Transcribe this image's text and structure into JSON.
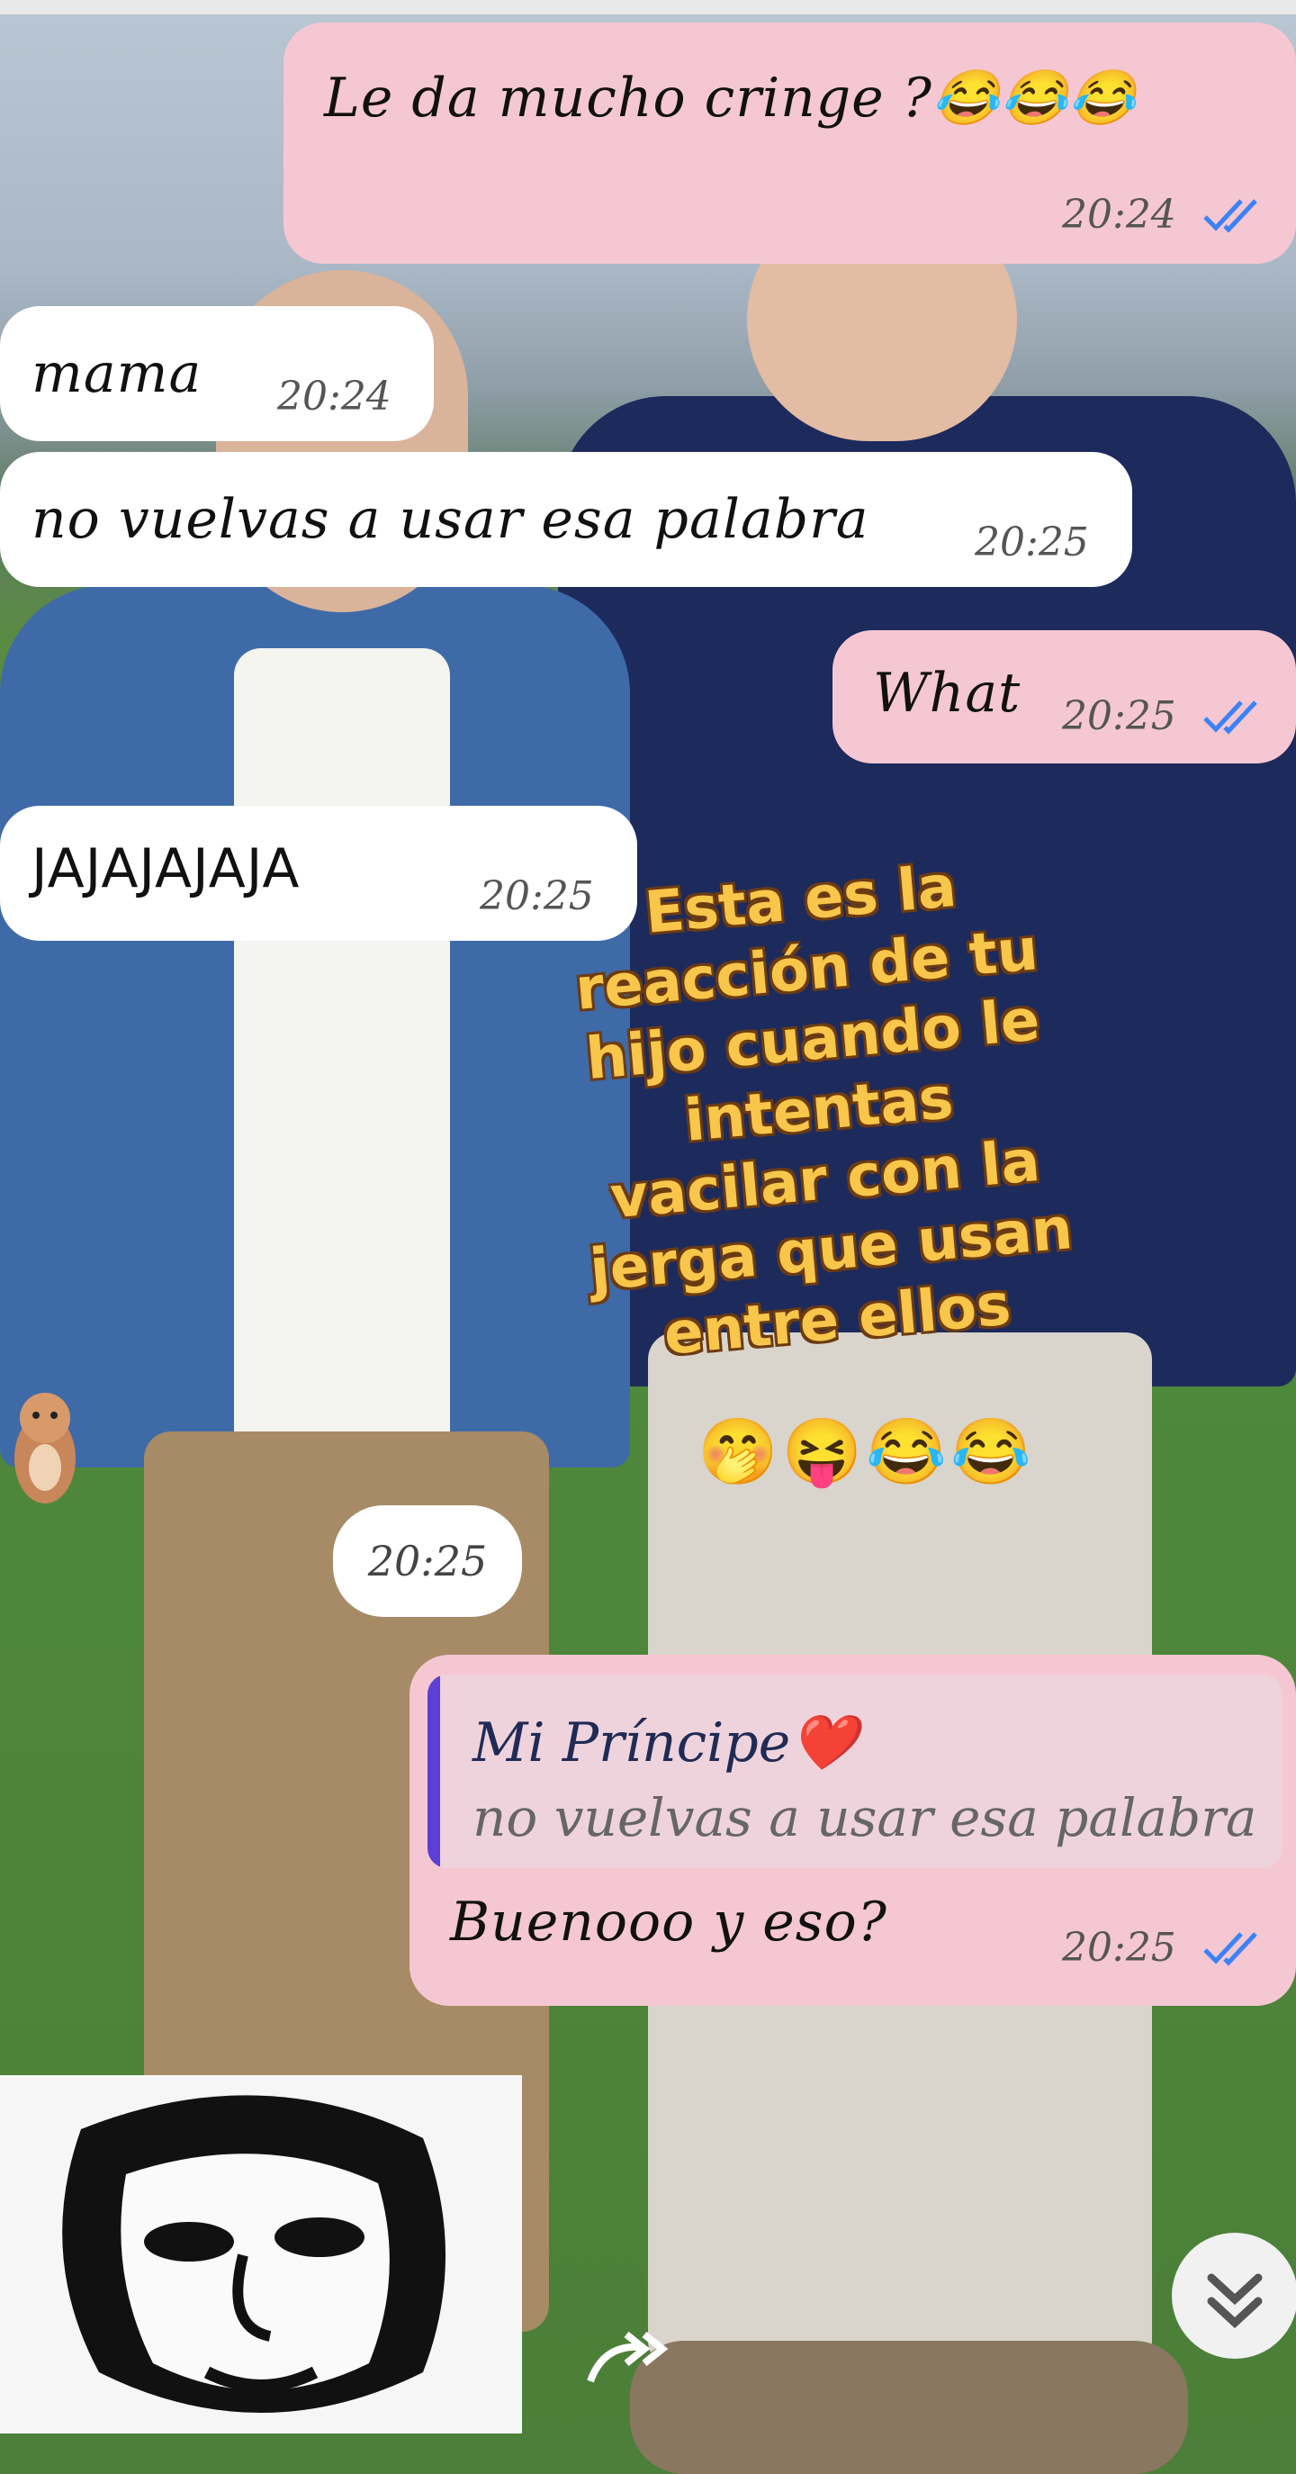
{
  "messages": [
    {
      "text": "Le da mucho cringe ?😂😂😂",
      "time": "20:24"
    },
    {
      "text": "mama",
      "time": "20:24"
    },
    {
      "text": "no vuelvas a usar esa palabra",
      "time": "20:25"
    },
    {
      "text": "What",
      "time": "20:25"
    },
    {
      "text": "JAJAJAJAJA",
      "time": "20:25"
    }
  ],
  "overlay": {
    "caption": "Esta es la reacción de tu hijo cuando le intentas vacilar con la jerga  que usan entre ellos",
    "emojis": "🤭😝😂😂"
  },
  "time_chip": "20:25",
  "reply": {
    "quoted_name": "Mi Príncipe❤️",
    "quoted_text": "no vuelvas a usar esa palabra",
    "text": "Buenooo y eso?",
    "time": "20:25"
  },
  "icons": {
    "read_ticks": "double-check-icon",
    "scroll_down": "chevron-double-down-icon",
    "forward": "forward-arrow-icon",
    "sticker": "hamster-sticker-icon"
  },
  "colors": {
    "outgoing_bubble": "#f5c7d3",
    "incoming_bubble": "#ffffff",
    "read_ticks": "#3b82f6",
    "overlay_text": "#f7c64a"
  }
}
